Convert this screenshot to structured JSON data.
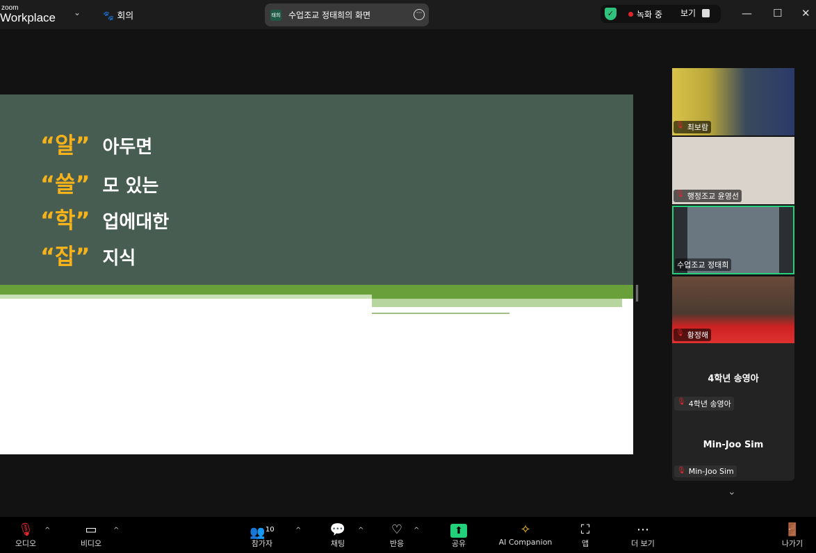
{
  "app": {
    "logo_small": "zoom",
    "logo_big": "Workplace",
    "meeting_label": "회의"
  },
  "share": {
    "badge": "태희",
    "title": "수업조교 정태희의 화면"
  },
  "recording": {
    "status": "녹화 중",
    "view_label": "보기"
  },
  "slide": {
    "rows": [
      {
        "quoted": "“알”",
        "rest": "아두면"
      },
      {
        "quoted": "“쓸”",
        "rest": "모 있는"
      },
      {
        "quoted": "“학”",
        "rest": "업에대한"
      },
      {
        "quoted": "“잡”",
        "rest": "지식"
      }
    ]
  },
  "participants": [
    {
      "name": "최보람",
      "bg": "#8a7a50"
    },
    {
      "name": "행정조교 윤영선",
      "bg": "#d9d3cc"
    },
    {
      "name": "수업조교 정태희",
      "bg": "#5a6a78",
      "active": true
    },
    {
      "name": "황정해",
      "bg": "#6a4a3a"
    }
  ],
  "no_video": [
    {
      "name": "4학년 송영아"
    },
    {
      "name": "Min-Joo Sim"
    }
  ],
  "toolbar": {
    "audio": "오디오",
    "video": "비디오",
    "participants": "참가자",
    "participant_count": "10",
    "chat": "채팅",
    "reactions": "반응",
    "share": "공유",
    "ai": "AI Companion",
    "apps": "앱",
    "more": "더 보기",
    "leave": "나가기"
  },
  "colors": {
    "accent_green": "#23d17a",
    "record_red": "#e0262b",
    "slide_green": "#485d51",
    "slide_yellow": "#f5b21b"
  }
}
